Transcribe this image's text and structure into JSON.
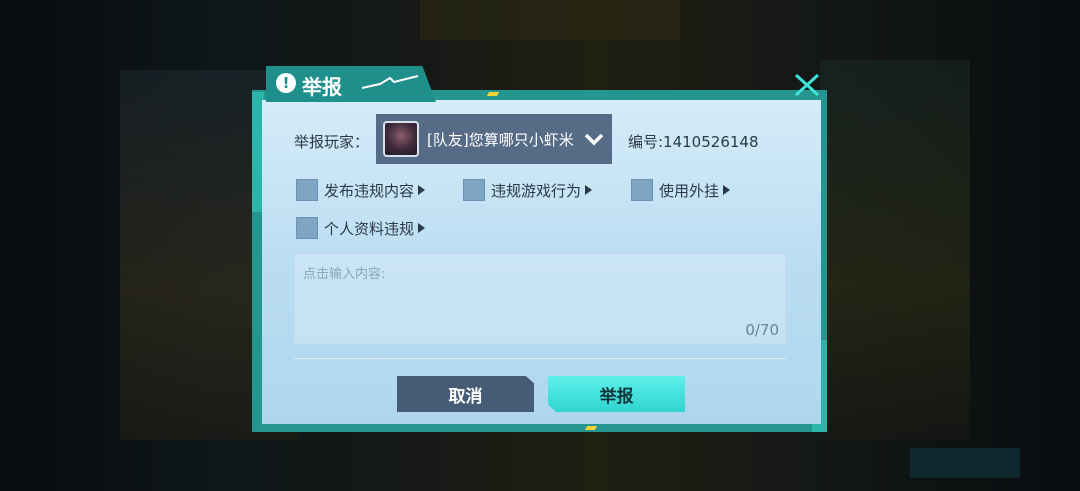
{
  "dialog": {
    "title": "举报",
    "close_icon": "close-icon",
    "accent_color": "#1e8f8a"
  },
  "player": {
    "label": "举报玩家：",
    "selected": "[队友]您算哪只小虾米",
    "id_text": "编号:1410526148"
  },
  "options": [
    {
      "label": "发布违规内容",
      "checked": false
    },
    {
      "label": "违规游戏行为",
      "checked": false
    },
    {
      "label": "使用外挂",
      "checked": false
    },
    {
      "label": "个人资料违规",
      "checked": false
    }
  ],
  "input": {
    "placeholder": "点击输入内容:",
    "counter": "0/70"
  },
  "buttons": {
    "cancel": "取消",
    "report": "举报"
  }
}
